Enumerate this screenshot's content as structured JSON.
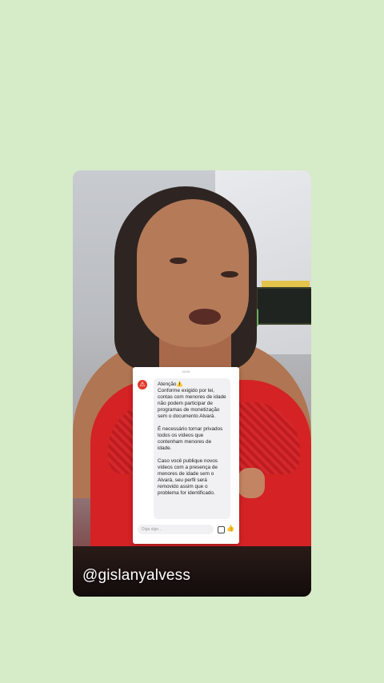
{
  "story": {
    "username": "@gislanyalvess"
  },
  "notice": {
    "time": "00:05",
    "title": "Atenção",
    "title_emoji": "⚠️",
    "paragraph_1": "Conforme exigido por lei, contas com menores de idade não podem participar de programas de monetização sem o documento Alvará.",
    "paragraph_2": "É necessário tornar privados todos os vídeos que contenham menores de idade.",
    "paragraph_3": "Caso você publique novos vídeos com a presença de menores de idade sem o Alvará, seu perfil será removido assim que o problema for identificado.",
    "compose_placeholder": "Diga algo..."
  },
  "icons": {
    "sender_avatar": "tiktok-alert-avatar-icon",
    "image": "image-icon",
    "like": "thumbs-up-icon"
  },
  "colors": {
    "background": "#d6ebc7",
    "alert_red": "#e43a2d",
    "dress_red": "#d42225"
  }
}
